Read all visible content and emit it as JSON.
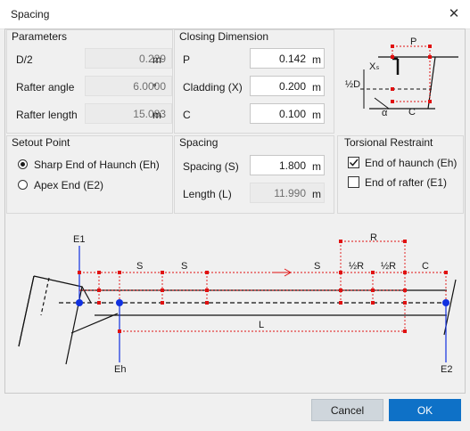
{
  "window": {
    "title": "Spacing",
    "close_glyph": "✕"
  },
  "parameters": {
    "title": "Parameters",
    "rows": [
      {
        "label": "D/2",
        "value": "0.229",
        "unit": "m"
      },
      {
        "label": "Rafter angle",
        "value": "6.0000",
        "unit": "°"
      },
      {
        "label": "Rafter length",
        "value": "15.083",
        "unit": "m"
      }
    ]
  },
  "closing": {
    "title": "Closing Dimension",
    "rows": [
      {
        "label": "P",
        "value": "0.142",
        "unit": "m"
      },
      {
        "label": "Cladding (X)",
        "value": "0.200",
        "unit": "m"
      },
      {
        "label": "C",
        "value": "0.100",
        "unit": "m"
      }
    ]
  },
  "closing_diagram": {
    "p": "P",
    "xs": "Xₛ",
    "half_d": "½D",
    "alpha": "α",
    "c": "C"
  },
  "setout": {
    "title": "Setout Point",
    "options": [
      {
        "label": "Sharp End of Haunch (Eh)",
        "selected": true
      },
      {
        "label": "Apex End (E2)",
        "selected": false
      }
    ]
  },
  "spacing": {
    "title": "Spacing",
    "rows": [
      {
        "label": "Spacing (S)",
        "value": "1.800",
        "unit": "m"
      },
      {
        "label": "Length (L)",
        "value": "11.990",
        "unit": "m"
      }
    ]
  },
  "torsional": {
    "title": "Torsional Restraint",
    "options": [
      {
        "label": "End of haunch (Eh)",
        "checked": true
      },
      {
        "label": "End of rafter (E1)",
        "checked": false
      }
    ]
  },
  "diagram": {
    "e1": "E1",
    "eh": "Eh",
    "e2": "E2",
    "s": "S",
    "r": "R",
    "half_r": "½R",
    "c": "C",
    "l": "L"
  },
  "buttons": {
    "cancel": "Cancel",
    "ok": "OK"
  },
  "colors": {
    "accent": "#0e71c7",
    "marker": "#e01010",
    "node": "#1030e0"
  }
}
